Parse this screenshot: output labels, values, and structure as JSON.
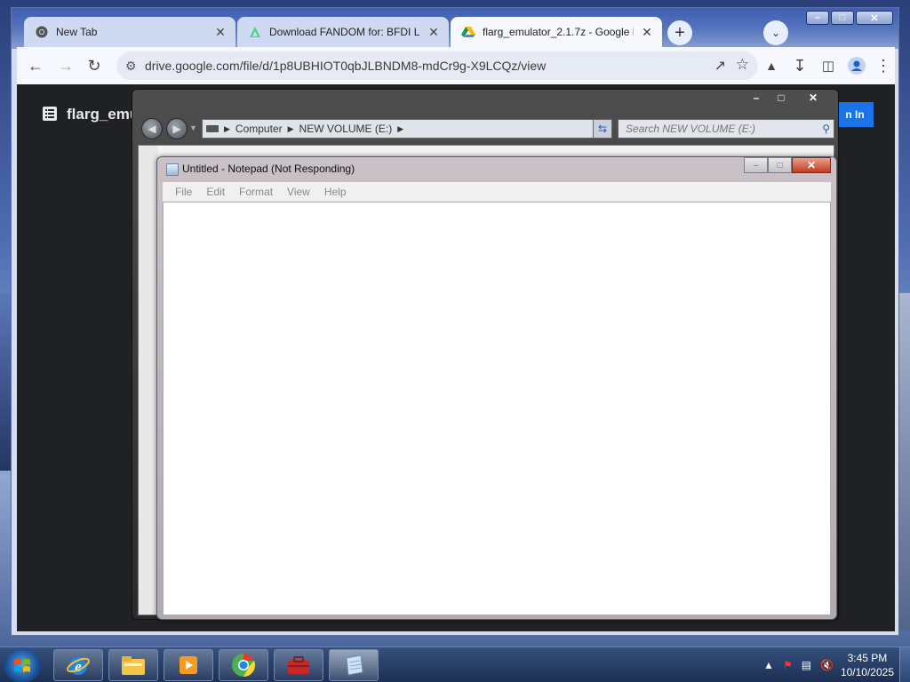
{
  "browser": {
    "tabs": [
      {
        "title": "New Tab",
        "icon": "chrome-icon",
        "active": false
      },
      {
        "title": "Download FANDOM for: BFDI Li",
        "icon": "fandom-icon",
        "active": false
      },
      {
        "title": "flarg_emulator_2.1.7z - Google D",
        "icon": "google-drive-icon",
        "active": true
      }
    ],
    "url": "drive.google.com/file/d/1p8UBHIOT0qbJLBNDM8-mdCr9g-X9LCQz/view",
    "page": {
      "file_title": "flarg_emu",
      "signin_label": "n In"
    }
  },
  "explorer": {
    "breadcrumbs": [
      "Computer",
      "NEW VOLUME (E:)"
    ],
    "search_placeholder": "Search NEW VOLUME (E:)"
  },
  "notepad": {
    "title": "Untitled - Notepad (Not Responding)",
    "menu": [
      "File",
      "Edit",
      "Format",
      "View",
      "Help"
    ],
    "content": ""
  },
  "taskbar": {
    "apps": [
      "internet-explorer",
      "file-explorer",
      "media-player",
      "chrome",
      "toolbox",
      "notepad"
    ],
    "time": "3:45 PM",
    "date": "10/10/2025"
  },
  "colors": {
    "chrome_frame": "#3e5fb0",
    "drive_page_bg": "#202124",
    "signin_blue": "#1a73e8",
    "notepad_close": "#c43a1f"
  }
}
